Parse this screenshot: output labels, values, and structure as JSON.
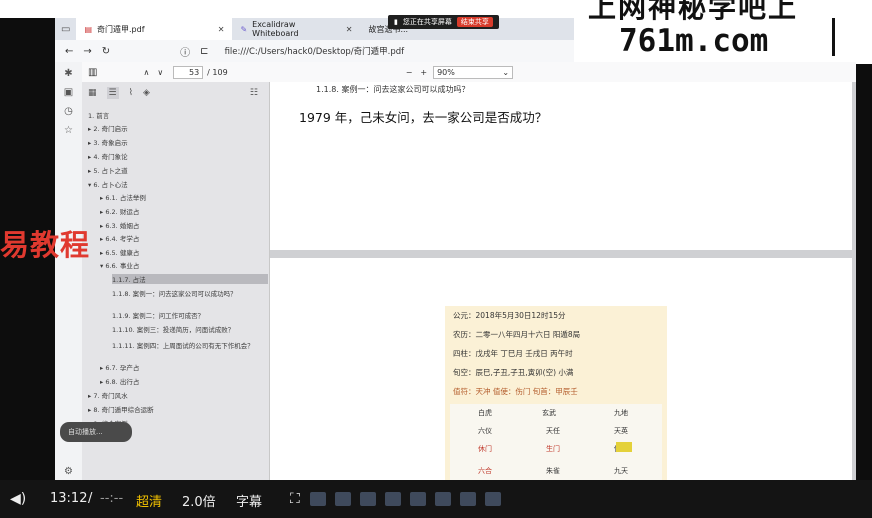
{
  "tabs": [
    {
      "label": "奇门遁甲.pdf"
    },
    {
      "label": "Excalidraw Whiteboard"
    },
    {
      "label": "故宫遗书..."
    }
  ],
  "share_bar": {
    "text": "您正在共享屏幕",
    "stop": "结束共享"
  },
  "watermark": {
    "line1": "上网神秘学吧上",
    "line2": "761m.com"
  },
  "address": {
    "url": "file:///C:/Users/hack0/Desktop/奇门遁甲.pdf"
  },
  "pdf": {
    "page": "53",
    "total": "/ 109",
    "zoom": "90%"
  },
  "outline": [
    {
      "label": "1. 前言",
      "indent": 0,
      "caret": ""
    },
    {
      "label": "2. 奇门启示",
      "indent": 0,
      "caret": "▸"
    },
    {
      "label": "3. 奇象启示",
      "indent": 0,
      "caret": "▸"
    },
    {
      "label": "4. 奇门象论",
      "indent": 0,
      "caret": "▸"
    },
    {
      "label": "5. 占卜之道",
      "indent": 0,
      "caret": "▸"
    },
    {
      "label": "6. 占卜心法",
      "indent": 0,
      "caret": "▾"
    },
    {
      "label": "6.1. 占法举例",
      "indent": 1,
      "caret": "▸"
    },
    {
      "label": "6.2. 财运占",
      "indent": 1,
      "caret": "▸"
    },
    {
      "label": "6.3. 婚姻占",
      "indent": 1,
      "caret": "▸"
    },
    {
      "label": "6.4. 考学占",
      "indent": 1,
      "caret": "▸"
    },
    {
      "label": "6.5. 健康占",
      "indent": 1,
      "caret": "▸"
    },
    {
      "label": "6.6. 事业占",
      "indent": 1,
      "caret": "▾"
    },
    {
      "label": "1.1.7. 占法",
      "indent": 2,
      "caret": "",
      "hl": true
    },
    {
      "label": "1.1.8. 案例一：问去这家公司可以成功吗？",
      "indent": 2,
      "caret": ""
    },
    {
      "label": "1.1.9. 案例二：问工作可成否？",
      "indent": 2,
      "caret": ""
    },
    {
      "label": "1.1.10. 案例三：投递简历，问面试成败？",
      "indent": 2,
      "caret": ""
    },
    {
      "label": "1.1.11. 案例四：上周面试的公司有无下作机会？",
      "indent": 2,
      "caret": ""
    },
    {
      "label": "6.7. 孕产占",
      "indent": 1,
      "caret": "▸"
    },
    {
      "label": "6.8. 出行占",
      "indent": 1,
      "caret": "▸"
    },
    {
      "label": "7. 奇门风水",
      "indent": 0,
      "caret": "▸"
    },
    {
      "label": "8. 奇门遁甲综合运断",
      "indent": 0,
      "caret": "▸"
    },
    {
      "label": "9. 综合案例",
      "indent": 0,
      "caret": "▸"
    }
  ],
  "page_heading": "1.1.8. 案例一：问去这家公司可以成功吗？",
  "question": "1979 年，己未女问，去一家公司是否成功？",
  "overlay_text": "易教程",
  "chart": {
    "lines": [
      "公元：2018年5月30日12时15分",
      "农历：二零一八年四月十六日  阳遁8局",
      "四柱：戊戌年  丁巳月  壬戌日  丙午时",
      "旬空：辰巳,子丑,子丑,寅卯(空)  小满",
      "值符：天冲  值使：伤门  旬首：甲辰壬"
    ],
    "cells": [
      "白虎",
      "玄武",
      "九地",
      "六仪",
      "天任",
      "天英",
      "休门",
      "生门",
      "伤门",
      "六合",
      "九天",
      "朱雀"
    ]
  },
  "badge": "自动播放...",
  "player": {
    "time": "13:12",
    "sep": "/",
    "dur": "--:--",
    "quality": "超清",
    "speed": "2.0倍",
    "subtitle": "字幕"
  }
}
